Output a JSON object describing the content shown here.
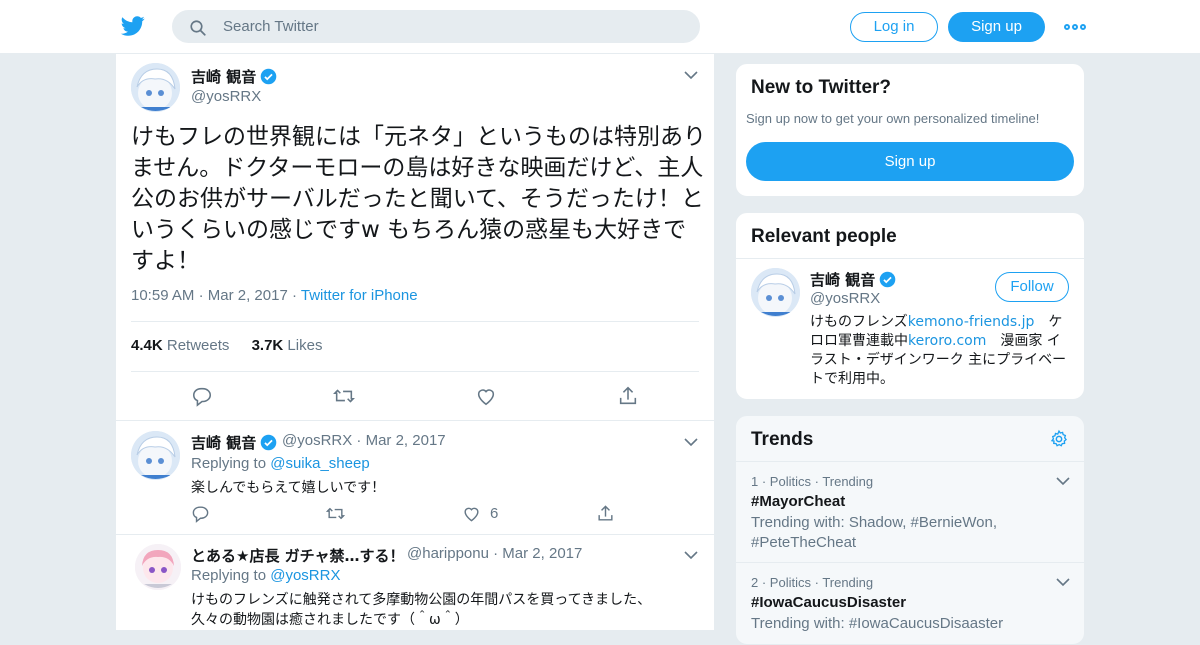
{
  "header": {
    "search_placeholder": "Search Twitter",
    "login_label": "Log in",
    "signup_label": "Sign up",
    "accent": "#1da1f2"
  },
  "main_tweet": {
    "display_name": "吉崎 観音",
    "handle": "@yosRRX",
    "verified": true,
    "text": "けもフレの世界観には「元ネタ」というものは特別ありません。ドクターモローの島は好きな映画だけど、主人公のお供がサーバルだったと聞いて、そうだったけ！というくらいの感じですw もちろん猿の惑星も大好きですよ！",
    "time": "10:59 AM",
    "date": "Mar 2, 2017",
    "source": "Twitter for iPhone",
    "retweets_count": "4.4K",
    "retweets_label": "Retweets",
    "likes_count": "3.7K",
    "likes_label": "Likes"
  },
  "replies": [
    {
      "display_name": "吉崎 観音",
      "handle": "@yosRRX",
      "date": "Mar 2, 2017",
      "replying_label": "Replying to",
      "replying_to": "@suika_sheep",
      "text": "楽しんでもらえて嬉しいです！",
      "like_count": "6"
    },
    {
      "display_name": "とある★店長 ガチャ禁…する！",
      "handle": "@haripponu",
      "date": "Mar 2, 2017",
      "replying_label": "Replying to",
      "replying_to": "@yosRRX",
      "text_line1": "けものフレンズに触発されて多摩動物公園の年間パスを買ってきました、",
      "text_line2": "久々の動物園は癒されましたです（＾ω＾）"
    }
  ],
  "new_to_twitter": {
    "title": "New to Twitter?",
    "subtitle": "Sign up now to get your own personalized timeline!",
    "button": "Sign up"
  },
  "relevant_people": {
    "title": "Relevant people",
    "display_name": "吉崎 観音",
    "handle": "@yosRRX",
    "follow_label": "Follow",
    "bio_1": "けものフレンズ",
    "bio_link_1": "kemono-friends.jp",
    "bio_2": "　ケロロ軍曹連載中",
    "bio_link_2": "keroro.com",
    "bio_3": "　漫画家 イラスト・デザインワーク 主にプライベートで利用中。"
  },
  "trends": {
    "title": "Trends",
    "items": [
      {
        "rank": "1",
        "category": "Politics",
        "status": "Trending",
        "tag": "#MayorCheat",
        "with_label": "Trending with:",
        "with_1": "Shadow, #BernieWon,",
        "with_2": "#PeteTheCheat"
      },
      {
        "rank": "2",
        "category": "Politics",
        "status": "Trending",
        "tag": "#IowaCaucusDisaster",
        "with_label": "Trending with:",
        "with_1": "#IowaCaucusDisaaster"
      }
    ]
  },
  "icons": [
    "twitter-bird-icon",
    "search-icon",
    "more-dots-icon",
    "verified-icon",
    "chevron-down-icon",
    "reply-icon",
    "retweet-icon",
    "like-icon",
    "share-icon",
    "settings-gear-icon"
  ]
}
